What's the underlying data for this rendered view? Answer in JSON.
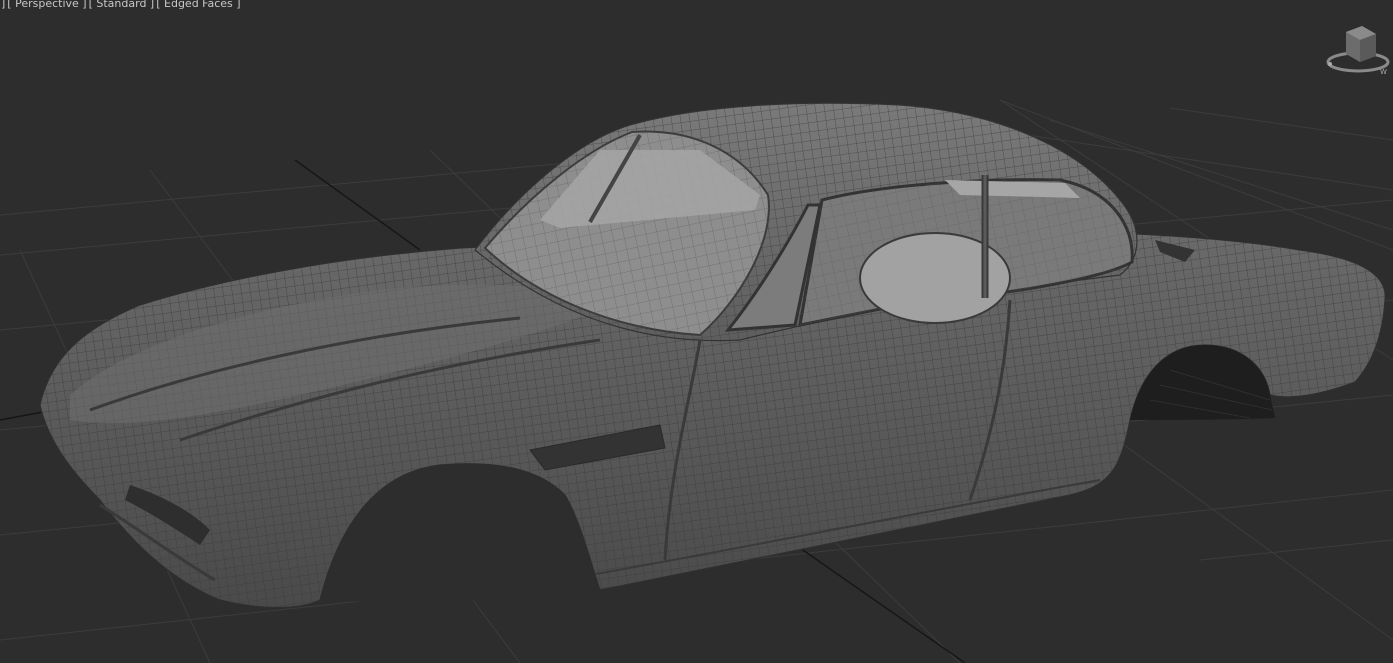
{
  "viewport": {
    "menu_bracket": "]",
    "view_label": "[ Perspective ]",
    "shading_label": "[ Standard ]",
    "display_label": "[ Edged Faces ]"
  },
  "icons": {
    "viewcube": "viewcube-icon"
  },
  "colors": {
    "background": "#2d2d2d",
    "grid": "#3c3c3c",
    "grid_axis": "#151515",
    "mesh_body": "#5c5c5c",
    "mesh_wire": "#3a3a3a",
    "glass": "#9a9a9a"
  }
}
